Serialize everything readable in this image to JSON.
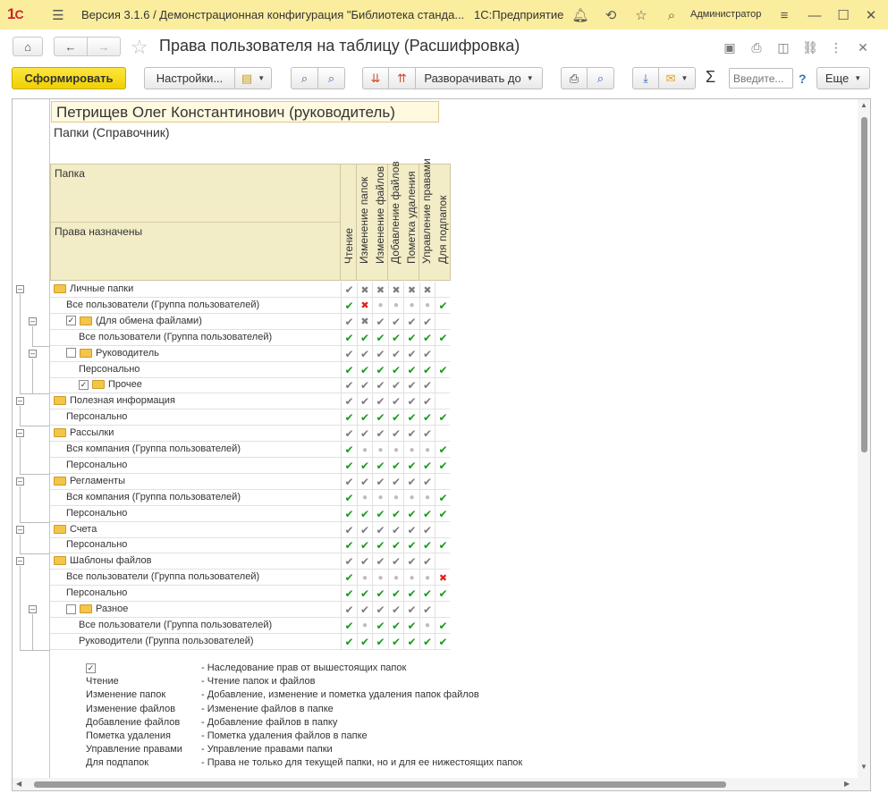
{
  "app": {
    "title": "Версия 3.1.6 / Демонстрационная конфигурация \"Библиотека станда...",
    "platform": "1С:Предприятие",
    "user": "Администратор"
  },
  "form": {
    "title": "Права пользователя на таблицу (Расшифровка)"
  },
  "toolbar": {
    "generate": "Сформировать",
    "settings": "Настройки...",
    "expand": "Разворачивать до",
    "search_placeholder": "Введите...",
    "help": "?",
    "more": "Еще",
    "sigma": "Σ"
  },
  "report": {
    "user_name": "Петрищев Олег Константинович (руководитель)",
    "object": "Папки (Справочник)",
    "header_folder": "Папка",
    "header_assigned": "Права назначены",
    "columns": [
      "Чтение",
      "Изменение папок",
      "Изменение файлов",
      "Добавление файлов",
      "Пометка удаления",
      "Управление правами",
      "Для подпапок"
    ],
    "rows": [
      {
        "label": "Личные папки",
        "indent": 0,
        "type": "folder",
        "check": "none",
        "cells": [
          "i",
          "x",
          "x",
          "x",
          "x",
          "x",
          ""
        ]
      },
      {
        "label": "Все пользователи (Группа пользователей)",
        "indent": 1,
        "type": "text",
        "cells": [
          "o",
          "d",
          ".",
          ".",
          ".",
          ".",
          "o"
        ]
      },
      {
        "label": "(Для обмена файлами)",
        "indent": 1,
        "type": "folder",
        "check": "checked",
        "cells": [
          "i",
          "x",
          "i",
          "i",
          "i",
          "i",
          ""
        ]
      },
      {
        "label": "Все пользователи (Группа пользователей)",
        "indent": 2,
        "type": "text",
        "cells": [
          "o",
          "o",
          "o",
          "o",
          "o",
          "o",
          "o"
        ]
      },
      {
        "label": "Руководитель",
        "indent": 1,
        "type": "folder",
        "check": "unchecked",
        "cells": [
          "i",
          "i",
          "i",
          "i",
          "i",
          "i",
          ""
        ]
      },
      {
        "label": "Персонально",
        "indent": 2,
        "type": "text",
        "cells": [
          "o",
          "o",
          "o",
          "o",
          "o",
          "o",
          "o"
        ]
      },
      {
        "label": "Прочее",
        "indent": 2,
        "type": "folder",
        "check": "checked",
        "cells": [
          "i",
          "i",
          "i",
          "i",
          "i",
          "i",
          ""
        ]
      },
      {
        "label": "Полезная информация",
        "indent": 0,
        "type": "folder",
        "check": "none",
        "cells": [
          "i",
          "i",
          "i",
          "i",
          "i",
          "i",
          ""
        ]
      },
      {
        "label": "Персонально",
        "indent": 1,
        "type": "text",
        "cells": [
          "o",
          "o",
          "o",
          "o",
          "o",
          "o",
          "o"
        ]
      },
      {
        "label": "Рассылки",
        "indent": 0,
        "type": "folder",
        "check": "none",
        "cells": [
          "i",
          "i",
          "i",
          "i",
          "i",
          "i",
          ""
        ]
      },
      {
        "label": "Вся компания (Группа пользователей)",
        "indent": 1,
        "type": "text",
        "cells": [
          "o",
          ".",
          ".",
          ".",
          ".",
          ".",
          "o"
        ]
      },
      {
        "label": "Персонально",
        "indent": 1,
        "type": "text",
        "cells": [
          "o",
          "o",
          "o",
          "o",
          "o",
          "o",
          "o"
        ]
      },
      {
        "label": "Регламенты",
        "indent": 0,
        "type": "folder",
        "check": "none",
        "cells": [
          "i",
          "i",
          "i",
          "i",
          "i",
          "i",
          ""
        ]
      },
      {
        "label": "Вся компания (Группа пользователей)",
        "indent": 1,
        "type": "text",
        "cells": [
          "o",
          ".",
          ".",
          ".",
          ".",
          ".",
          "o"
        ]
      },
      {
        "label": "Персонально",
        "indent": 1,
        "type": "text",
        "cells": [
          "o",
          "o",
          "o",
          "o",
          "o",
          "o",
          "o"
        ]
      },
      {
        "label": "Счета",
        "indent": 0,
        "type": "folder",
        "check": "none",
        "cells": [
          "i",
          "i",
          "i",
          "i",
          "i",
          "i",
          ""
        ]
      },
      {
        "label": "Персонально",
        "indent": 1,
        "type": "text",
        "cells": [
          "o",
          "o",
          "o",
          "o",
          "o",
          "o",
          "o"
        ]
      },
      {
        "label": "Шаблоны файлов",
        "indent": 0,
        "type": "folder",
        "check": "none",
        "cells": [
          "i",
          "i",
          "i",
          "i",
          "i",
          "i",
          ""
        ]
      },
      {
        "label": "Все пользователи (Группа пользователей)",
        "indent": 1,
        "type": "text",
        "cells": [
          "o",
          ".",
          ".",
          ".",
          ".",
          ".",
          "d"
        ]
      },
      {
        "label": "Персонально",
        "indent": 1,
        "type": "text",
        "cells": [
          "o",
          "o",
          "o",
          "o",
          "o",
          "o",
          "o"
        ]
      },
      {
        "label": "Разное",
        "indent": 1,
        "type": "folder",
        "check": "unchecked",
        "cells": [
          "i",
          "i",
          "i",
          "i",
          "i",
          "i",
          ""
        ]
      },
      {
        "label": "Все пользователи (Группа пользователей)",
        "indent": 2,
        "type": "text",
        "cells": [
          "o",
          ".",
          "o",
          "o",
          "o",
          ".",
          "o"
        ]
      },
      {
        "label": "Руководители (Группа пользователей)",
        "indent": 2,
        "type": "text",
        "cells": [
          "o",
          "o",
          "o",
          "o",
          "o",
          "o",
          "o"
        ]
      }
    ],
    "legend": [
      {
        "key": "",
        "value": "- Наследование прав от вышестоящих папок",
        "is_check": true
      },
      {
        "key": "Чтение",
        "value": "- Чтение папок и файлов"
      },
      {
        "key": "Изменение папок",
        "value": "- Добавление, изменение и пометка удаления папок файлов"
      },
      {
        "key": "Изменение файлов",
        "value": "- Изменение файлов в папке"
      },
      {
        "key": "Добавление файлов",
        "value": "- Добавление файлов в папку"
      },
      {
        "key": "Пометка удаления",
        "value": "- Пометка удаления файлов в папке"
      },
      {
        "key": "Управление правами",
        "value": "- Управление правами папки"
      },
      {
        "key": "Для подпапок",
        "value": "- Права не только для текущей папки, но и для ее нижестоящих папок"
      }
    ]
  }
}
